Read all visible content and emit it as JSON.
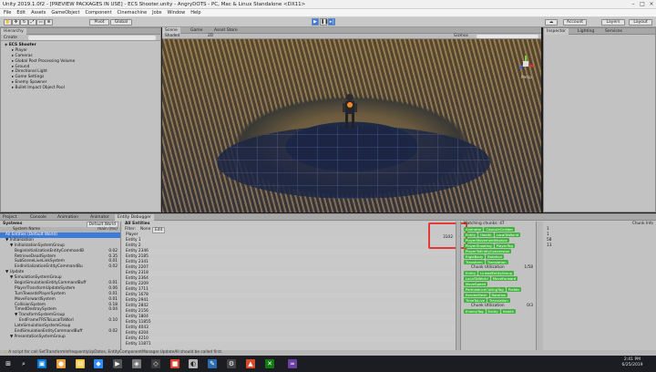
{
  "window": {
    "title": "Unity 2019.1.0f2 - [PREVIEW PACKAGES IN USE] - ECS Shooter.unity - AngryDOTS - PC, Mac & Linux Standalone <DX11>"
  },
  "menu": [
    "File",
    "Edit",
    "Assets",
    "GameObject",
    "Component",
    "Cinemachine",
    "Jobs",
    "Window",
    "Help"
  ],
  "toolbar": {
    "pivot_label": "Pivot",
    "global_label": "Global",
    "account_label": "Account",
    "layers_label": "Layers",
    "layout_label": "Layout"
  },
  "hierarchy": {
    "tab": "Hierarchy",
    "create_label": "Create",
    "root": "ECS Shooter",
    "items": [
      "Player",
      "Cameras",
      "Global Post Processing Volume",
      "Ground",
      "Directional Light",
      "Game Settings",
      "Enemy Spawner",
      "Bullet Impact Object Pool"
    ]
  },
  "scene": {
    "tabs": [
      "Scene",
      "Game",
      "Asset Store"
    ],
    "shaded_label": "Shaded",
    "mode_label": "2D",
    "gizmos_label": "Gizmos",
    "persp_label": "Persp"
  },
  "inspector": {
    "tabs": [
      "Inspector",
      "Lighting",
      "Services"
    ]
  },
  "bottom_tabs": [
    "Project",
    "Console",
    "Animation",
    "Animator",
    "Entity Debugger"
  ],
  "systems_panel": {
    "header": "Systems",
    "world_label": "Default World",
    "col_system": "System Name",
    "col_ms": "main (ms)",
    "rows": [
      {
        "name": "All Entities (Default World)",
        "ms": "",
        "indent": 0,
        "selected": true
      },
      {
        "name": "▼ Initialization",
        "ms": "",
        "indent": 0
      },
      {
        "name": "▼ InitializationSystemGroup",
        "ms": "",
        "indent": 1
      },
      {
        "name": "BeginInitializationEntityCommandB",
        "ms": "0.02",
        "indent": 2
      },
      {
        "name": "RetrieveDeadSystem",
        "ms": "0.35",
        "indent": 2
      },
      {
        "name": "SubSceneLiveLinkSystem",
        "ms": "0.01",
        "indent": 2
      },
      {
        "name": "EndInitializationEntityCommandBu",
        "ms": "0.02",
        "indent": 2
      },
      {
        "name": "▼ Update",
        "ms": "",
        "indent": 0
      },
      {
        "name": "▼ SimulationSystemGroup",
        "ms": "",
        "indent": 1
      },
      {
        "name": "BeginSimulationEntityCommandBuff",
        "ms": "0.01",
        "indent": 2
      },
      {
        "name": "PlayerTransformUpdateSystem",
        "ms": "0.06",
        "indent": 2
      },
      {
        "name": "TurnTowardsPlayerSystem",
        "ms": "0.01",
        "indent": 2
      },
      {
        "name": "MoveForwardSystem",
        "ms": "0.01",
        "indent": 2
      },
      {
        "name": "CollisionSystem",
        "ms": "0.18",
        "indent": 2
      },
      {
        "name": "TimedDestroySystem",
        "ms": "0.04",
        "indent": 2
      },
      {
        "name": "▼ TransformSystemGroup",
        "ms": "",
        "indent": 2
      },
      {
        "name": "EndFrameTRSToLocalToWorl",
        "ms": "0.10",
        "indent": 3
      },
      {
        "name": "LateSimulationSystemGroup",
        "ms": "",
        "indent": 2
      },
      {
        "name": "EndSimulationEntityCommandBuff",
        "ms": "0.02",
        "indent": 2
      },
      {
        "name": "▼ PresentationSystemGroup",
        "ms": "",
        "indent": 1
      }
    ]
  },
  "entities_panel": {
    "header": "All Entities",
    "filter_label": "Filter:",
    "none_label": "None",
    "edit_label": "Edit",
    "count": "3102",
    "rows": [
      "Player",
      "Entity 1",
      "Entity 2",
      "Entity 2346",
      "Entity 2185",
      "Entity 2341",
      "Entity 2207",
      "Entity 2318",
      "Entity 2364",
      "Entity 2209",
      "Entity 1711",
      "Entity 1678",
      "Entity 2941",
      "Entity 2842",
      "Entity 2156",
      "Entity 1804",
      "Entity 11855",
      "Entity 4043",
      "Entity 4204",
      "Entity 4210",
      "Entity 11871"
    ]
  },
  "chunks_panel": {
    "header": "Matching chunks: 47",
    "info_label": "Chunk Info",
    "chunks": [
      {
        "chips": [
          [
            "Animator",
            "CapsuleCollider"
          ],
          [
            "Entity",
            "Health",
            "LocalToWorld"
          ],
          [
            "PlayerMovementModule"
          ],
          [
            "PlayerShooting",
            "PlayerTag"
          ],
          [
            "PlayerToEntityConversion"
          ],
          [
            "RigidBody",
            "Rotation"
          ],
          [
            "Transform",
            "Translation"
          ]
        ]
      },
      {
        "label": "Chunk Utilization",
        "value": "1/58"
      },
      {
        "chips": [
          [
            "Entity",
            "LinkedEntityGroup"
          ],
          [
            "LocalToWorld",
            "MoveForward"
          ],
          [
            "MoveSpeed"
          ],
          [
            "PerInstanceCullingTag",
            "Prefab"
          ],
          [
            "RenderMesh",
            "Rotation"
          ],
          [
            "TimeToLive",
            "Translation"
          ]
        ]
      },
      {
        "label": "Chunk Utilization",
        "value": "0/3"
      },
      {
        "chips": [
          [
            "EnemyTag",
            "Entity",
            "Health"
          ]
        ]
      }
    ],
    "row_values": [
      "1",
      "1",
      "58",
      "13"
    ]
  },
  "status": {
    "message": "A script for call SetTransformInfrequentlyUpDates, EntityComponentManager.UpdateAll should be called first."
  },
  "taskbar": {
    "time": "2:41 PM",
    "date": "6/25/2019"
  },
  "colors": {
    "highlight_box": "#e53935",
    "chip_green": "#42b33f",
    "selection": "#3d7bd8"
  }
}
